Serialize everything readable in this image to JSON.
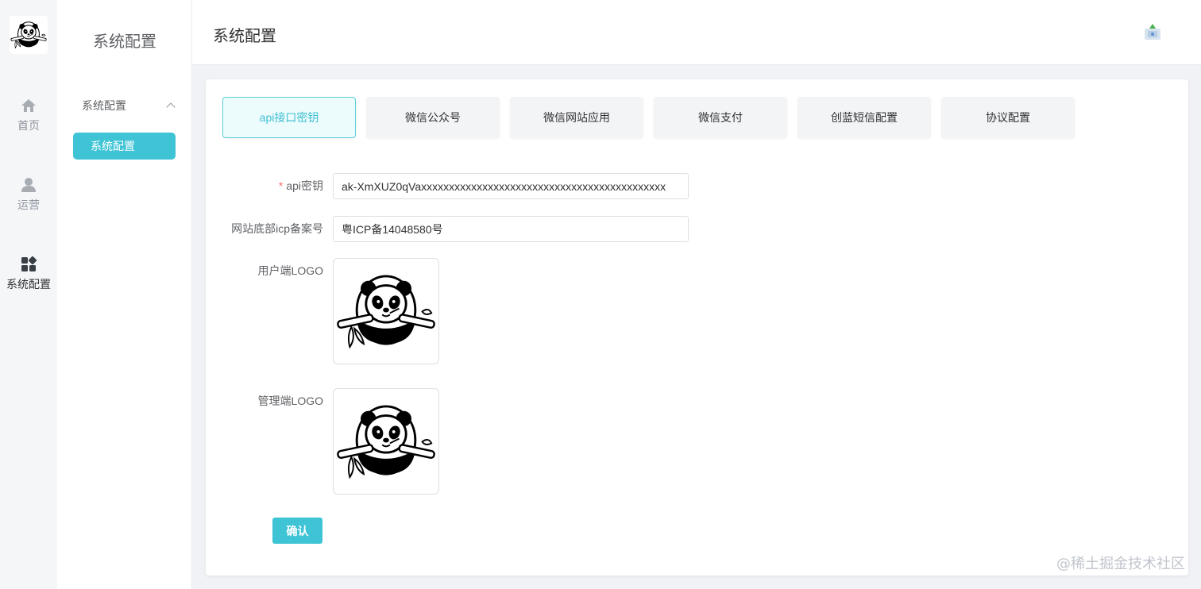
{
  "rail": {
    "items": [
      {
        "label": "首页",
        "icon": "home-icon"
      },
      {
        "label": "运营",
        "icon": "user-icon"
      },
      {
        "label": "系统配置",
        "icon": "apps-icon"
      }
    ]
  },
  "subbar": {
    "title": "系统配置",
    "group_label": "系统配置",
    "active_item": "系统配置"
  },
  "header": {
    "title": "系统配置"
  },
  "tabs": [
    {
      "label": "api接口密钥"
    },
    {
      "label": "微信公众号"
    },
    {
      "label": "微信网站应用"
    },
    {
      "label": "微信支付"
    },
    {
      "label": "创蓝短信配置"
    },
    {
      "label": "协议配置"
    }
  ],
  "form": {
    "api_key_label": "api密钥",
    "api_key_value": "ak-XmXUZ0qVaxxxxxxxxxxxxxxxxxxxxxxxxxxxxxxxxxxxxxxxxxxxx",
    "icp_label": "网站底部icp备案号",
    "icp_value": "粤ICP备14048580号",
    "user_logo_label": "用户端LOGO",
    "admin_logo_label": "管理端LOGO",
    "confirm_label": "确认"
  },
  "watermark": "@稀土掘金技术社区",
  "colors": {
    "accent": "#3fc4d6",
    "required": "#f56c6c"
  }
}
